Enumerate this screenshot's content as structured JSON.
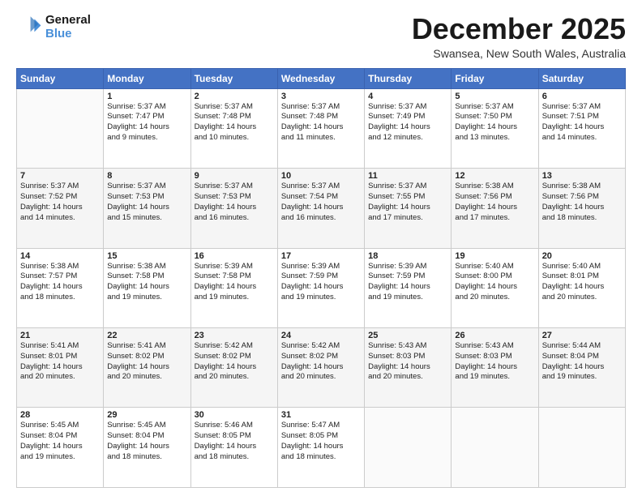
{
  "logo": {
    "line1": "General",
    "line2": "Blue"
  },
  "title": "December 2025",
  "subtitle": "Swansea, New South Wales, Australia",
  "days_header": [
    "Sunday",
    "Monday",
    "Tuesday",
    "Wednesday",
    "Thursday",
    "Friday",
    "Saturday"
  ],
  "weeks": [
    [
      {
        "day": "",
        "info": ""
      },
      {
        "day": "1",
        "info": "Sunrise: 5:37 AM\nSunset: 7:47 PM\nDaylight: 14 hours\nand 9 minutes."
      },
      {
        "day": "2",
        "info": "Sunrise: 5:37 AM\nSunset: 7:48 PM\nDaylight: 14 hours\nand 10 minutes."
      },
      {
        "day": "3",
        "info": "Sunrise: 5:37 AM\nSunset: 7:48 PM\nDaylight: 14 hours\nand 11 minutes."
      },
      {
        "day": "4",
        "info": "Sunrise: 5:37 AM\nSunset: 7:49 PM\nDaylight: 14 hours\nand 12 minutes."
      },
      {
        "day": "5",
        "info": "Sunrise: 5:37 AM\nSunset: 7:50 PM\nDaylight: 14 hours\nand 13 minutes."
      },
      {
        "day": "6",
        "info": "Sunrise: 5:37 AM\nSunset: 7:51 PM\nDaylight: 14 hours\nand 14 minutes."
      }
    ],
    [
      {
        "day": "7",
        "info": "Sunrise: 5:37 AM\nSunset: 7:52 PM\nDaylight: 14 hours\nand 14 minutes."
      },
      {
        "day": "8",
        "info": "Sunrise: 5:37 AM\nSunset: 7:53 PM\nDaylight: 14 hours\nand 15 minutes."
      },
      {
        "day": "9",
        "info": "Sunrise: 5:37 AM\nSunset: 7:53 PM\nDaylight: 14 hours\nand 16 minutes."
      },
      {
        "day": "10",
        "info": "Sunrise: 5:37 AM\nSunset: 7:54 PM\nDaylight: 14 hours\nand 16 minutes."
      },
      {
        "day": "11",
        "info": "Sunrise: 5:37 AM\nSunset: 7:55 PM\nDaylight: 14 hours\nand 17 minutes."
      },
      {
        "day": "12",
        "info": "Sunrise: 5:38 AM\nSunset: 7:56 PM\nDaylight: 14 hours\nand 17 minutes."
      },
      {
        "day": "13",
        "info": "Sunrise: 5:38 AM\nSunset: 7:56 PM\nDaylight: 14 hours\nand 18 minutes."
      }
    ],
    [
      {
        "day": "14",
        "info": "Sunrise: 5:38 AM\nSunset: 7:57 PM\nDaylight: 14 hours\nand 18 minutes."
      },
      {
        "day": "15",
        "info": "Sunrise: 5:38 AM\nSunset: 7:58 PM\nDaylight: 14 hours\nand 19 minutes."
      },
      {
        "day": "16",
        "info": "Sunrise: 5:39 AM\nSunset: 7:58 PM\nDaylight: 14 hours\nand 19 minutes."
      },
      {
        "day": "17",
        "info": "Sunrise: 5:39 AM\nSunset: 7:59 PM\nDaylight: 14 hours\nand 19 minutes."
      },
      {
        "day": "18",
        "info": "Sunrise: 5:39 AM\nSunset: 7:59 PM\nDaylight: 14 hours\nand 19 minutes."
      },
      {
        "day": "19",
        "info": "Sunrise: 5:40 AM\nSunset: 8:00 PM\nDaylight: 14 hours\nand 20 minutes."
      },
      {
        "day": "20",
        "info": "Sunrise: 5:40 AM\nSunset: 8:01 PM\nDaylight: 14 hours\nand 20 minutes."
      }
    ],
    [
      {
        "day": "21",
        "info": "Sunrise: 5:41 AM\nSunset: 8:01 PM\nDaylight: 14 hours\nand 20 minutes."
      },
      {
        "day": "22",
        "info": "Sunrise: 5:41 AM\nSunset: 8:02 PM\nDaylight: 14 hours\nand 20 minutes."
      },
      {
        "day": "23",
        "info": "Sunrise: 5:42 AM\nSunset: 8:02 PM\nDaylight: 14 hours\nand 20 minutes."
      },
      {
        "day": "24",
        "info": "Sunrise: 5:42 AM\nSunset: 8:02 PM\nDaylight: 14 hours\nand 20 minutes."
      },
      {
        "day": "25",
        "info": "Sunrise: 5:43 AM\nSunset: 8:03 PM\nDaylight: 14 hours\nand 20 minutes."
      },
      {
        "day": "26",
        "info": "Sunrise: 5:43 AM\nSunset: 8:03 PM\nDaylight: 14 hours\nand 19 minutes."
      },
      {
        "day": "27",
        "info": "Sunrise: 5:44 AM\nSunset: 8:04 PM\nDaylight: 14 hours\nand 19 minutes."
      }
    ],
    [
      {
        "day": "28",
        "info": "Sunrise: 5:45 AM\nSunset: 8:04 PM\nDaylight: 14 hours\nand 19 minutes."
      },
      {
        "day": "29",
        "info": "Sunrise: 5:45 AM\nSunset: 8:04 PM\nDaylight: 14 hours\nand 18 minutes."
      },
      {
        "day": "30",
        "info": "Sunrise: 5:46 AM\nSunset: 8:05 PM\nDaylight: 14 hours\nand 18 minutes."
      },
      {
        "day": "31",
        "info": "Sunrise: 5:47 AM\nSunset: 8:05 PM\nDaylight: 14 hours\nand 18 minutes."
      },
      {
        "day": "",
        "info": ""
      },
      {
        "day": "",
        "info": ""
      },
      {
        "day": "",
        "info": ""
      }
    ]
  ]
}
